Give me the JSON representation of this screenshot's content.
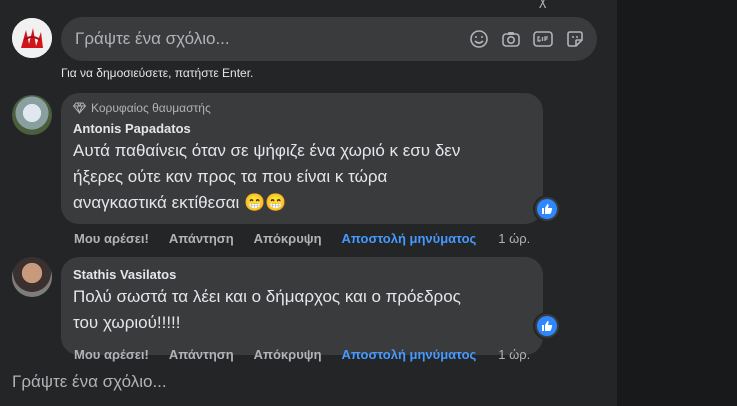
{
  "composer": {
    "placeholder": "Γράψτε ένα σχόλιο...",
    "hint": "Για να δημοσιεύσετε, πατήστε Enter."
  },
  "top_fragment": "χ",
  "comments": [
    {
      "badge": "Κορυφαίος θαυμαστής",
      "author": "Antonis Papadatos",
      "text": "Αυτά παθαίνεις όταν σε ψήφιζε ένα χωριό κ εσυ δεν\nήξερες ούτε καν προς τα που είναι κ τώρα\nαναγκαστικά εκτίθεσαι 😁😁",
      "actions": {
        "like": "Μου αρέσει!",
        "reply": "Απάντηση",
        "hide": "Απόκρυψη",
        "message": "Αποστολή μηνύματος",
        "time": "1 ώρ."
      }
    },
    {
      "badge": "",
      "author": "Stathis Vasilatos",
      "text": "Πολύ σωστά τα λέει και ο δήμαρχος και ο πρόεδρος\nτου χωριού!!!!!",
      "actions": {
        "like": "Μου αρέσει!",
        "reply": "Απάντηση",
        "hide": "Απόκρυψη",
        "message": "Αποστολή μηνύματος",
        "time": "1 ώρ."
      }
    }
  ],
  "bottom_prompt": "Γράψτε ένα σχόλιο...",
  "colors": {
    "accent": "#4599ff",
    "like": "#2d88ff",
    "panel": "#242526",
    "bubble": "#3a3b3c"
  },
  "icons": [
    "emoji-icon",
    "camera-icon",
    "gif-icon",
    "sticker-icon",
    "diamond-icon",
    "like-icon"
  ]
}
